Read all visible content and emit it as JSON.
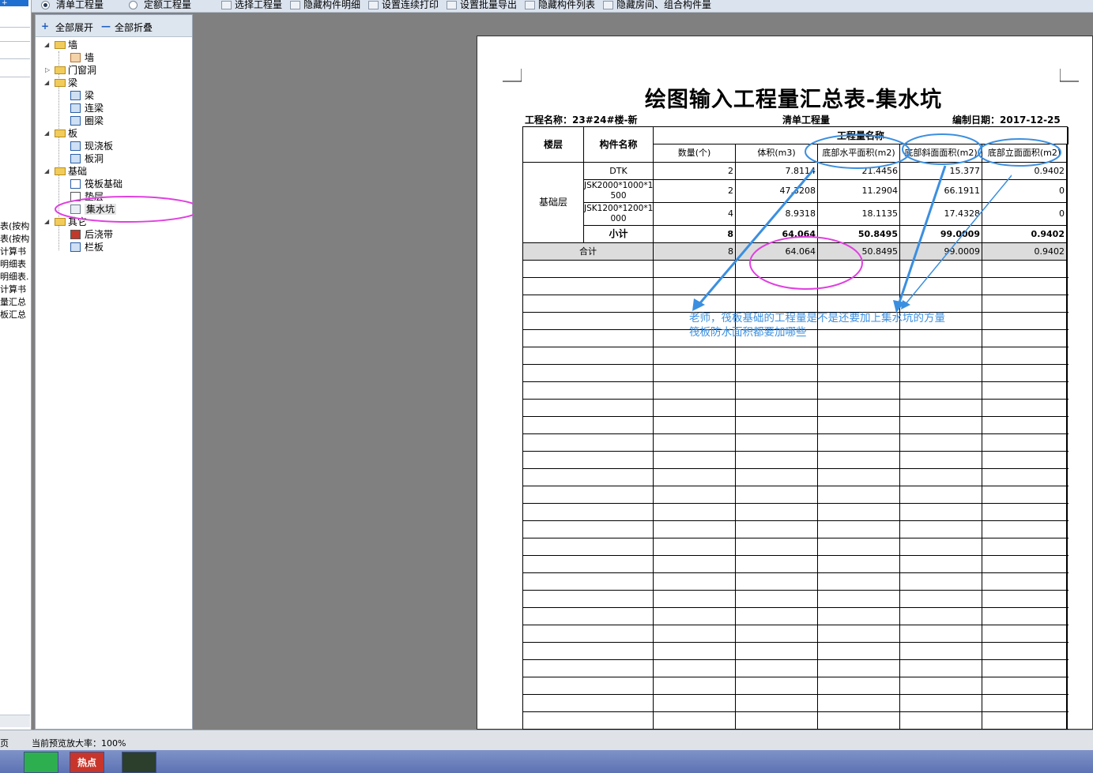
{
  "toolbar": {
    "qingdan": "清单工程量",
    "dinge": "定额工程量",
    "select_qty": "选择工程量",
    "hide_detail": "隐藏构件明细",
    "cont_print": "设置连续打印",
    "batch_export": "设置批量导出",
    "hide_list": "隐藏构件列表",
    "hide_room": "隐藏房间、组合构件量"
  },
  "left_strip": {
    "top_btn": "+",
    "items": [
      "表(按构",
      "表(按构",
      "计算书",
      "明细表",
      "明细表.",
      "计算书",
      "量汇总",
      "板汇总"
    ]
  },
  "tree": {
    "expand_all": "全部展开",
    "collapse_all": "全部折叠",
    "n_wall": "墙",
    "n_wall_c": "墙",
    "n_door": "门窗洞",
    "n_beam": "梁",
    "n_beam_c": "梁",
    "n_lianliang": "连梁",
    "n_quanliang": "圈梁",
    "n_slab": "板",
    "n_xianjiao": "现浇板",
    "n_bandong": "板洞",
    "n_found": "基础",
    "n_fabanjichu": "筏板基础",
    "n_dianceng": "垫层",
    "n_jishuikeng": "集水坑",
    "n_other": "其它",
    "n_houjiaodai": "后浇带",
    "n_lanban": "栏板"
  },
  "report": {
    "title": "绘图输入工程量汇总表-集水坑",
    "project": "工程名称：23#24#楼-新",
    "qty_type": "清单工程量",
    "date": "编制日期：2017-12-25",
    "h_floor": "楼层",
    "h_name": "构件名称",
    "h_group": "工程量名称",
    "h_count": "数量(个)",
    "h_vol": "体积(m3)",
    "h_bottom": "底部水平面积(m2)",
    "h_slope": "底部斜面面积(m2)",
    "h_side": "底部立面面积(m2)",
    "floor": "基础层",
    "r1": {
      "name": "DTK",
      "count": "2",
      "vol": "7.8114",
      "bottom": "21.4456",
      "slope": "15.377",
      "side": "0.9402"
    },
    "r2": {
      "name1": "JSK2000*1000*1",
      "name2": "500",
      "count": "2",
      "vol": "47.3208",
      "bottom": "11.2904",
      "slope": "66.1911",
      "side": "0"
    },
    "r3": {
      "name1": "JSK1200*1200*1",
      "name2": "000",
      "count": "4",
      "vol": "8.9318",
      "bottom": "18.1135",
      "slope": "17.4328",
      "side": "0"
    },
    "sub": {
      "label": "小计",
      "count": "8",
      "vol": "64.064",
      "bottom": "50.8495",
      "slope": "99.0009",
      "side": "0.9402"
    },
    "total": {
      "label": "合计",
      "count": "8",
      "vol": "64.064",
      "bottom": "50.8495",
      "slope": "99.0009",
      "side": "0.9402"
    }
  },
  "annotation": {
    "line1": "老师，筏板基础的工程量是不是还要加上集水坑的方量",
    "line2": "筏板防水面积都要加哪些"
  },
  "status": {
    "left": "页",
    "zoom": "当前预览放大率：100%"
  },
  "taskbar": {
    "hot": "热点"
  },
  "colors": {
    "annotation_blue": "#3b8fe0",
    "annotation_magenta": "#e040e0"
  }
}
